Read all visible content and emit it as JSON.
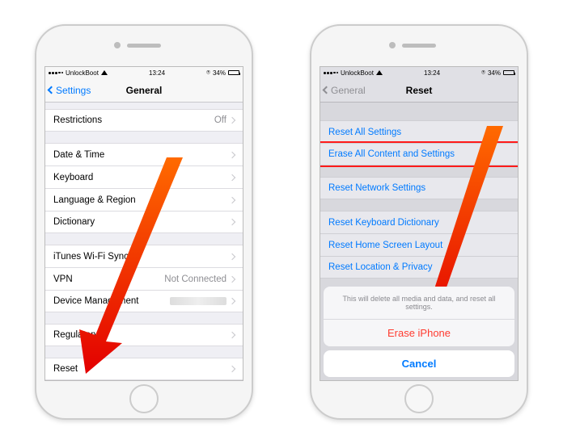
{
  "status": {
    "carrier": "UnlockBoot",
    "time": "13:24",
    "battery": "34%"
  },
  "left": {
    "back": "Settings",
    "title": "General",
    "rows": {
      "restrictions": "Restrictions",
      "restrictions_val": "Off",
      "date_time": "Date & Time",
      "keyboard": "Keyboard",
      "language_region": "Language & Region",
      "dictionary": "Dictionary",
      "itunes_wifi": "iTunes Wi-Fi Sync",
      "vpn": "VPN",
      "vpn_val": "Not Connected",
      "device_mgmt": "Device Management",
      "regulatory": "Regulatory",
      "reset": "Reset"
    }
  },
  "right": {
    "back": "General",
    "title": "Reset",
    "rows": {
      "reset_all": "Reset All Settings",
      "erase_all": "Erase All Content and Settings",
      "reset_network": "Reset Network Settings",
      "reset_keyboard": "Reset Keyboard Dictionary",
      "reset_home": "Reset Home Screen Layout",
      "reset_location": "Reset Location & Privacy"
    },
    "sheet": {
      "msg": "This will delete all media and data, and reset all settings.",
      "erase": "Erase iPhone",
      "cancel": "Cancel"
    }
  }
}
